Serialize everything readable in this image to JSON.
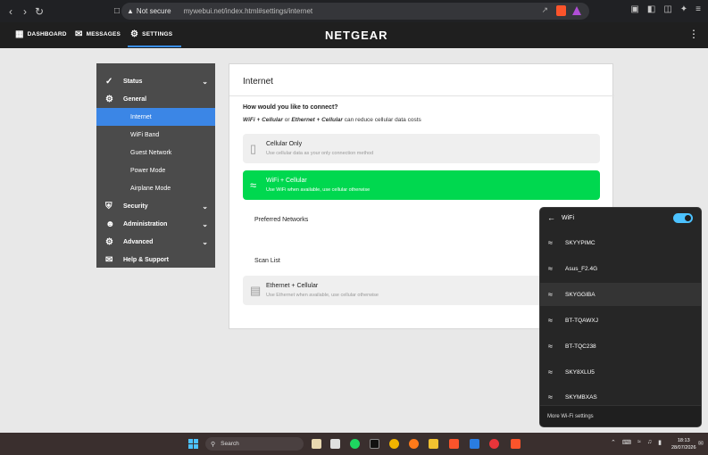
{
  "browser": {
    "security_label": "Not secure",
    "url": "mywebui.net/index.html#settings/internet"
  },
  "appnav": {
    "brand": "NETGEAR",
    "items": [
      "DASHBOARD",
      "MESSAGES",
      "SETTINGS"
    ],
    "active": "SETTINGS"
  },
  "sidebar": {
    "status": "Status",
    "general": "General",
    "general_items": [
      "Internet",
      "WiFi Band",
      "Guest Network",
      "Power Mode",
      "Airplane Mode"
    ],
    "security": "Security",
    "administration": "Administration",
    "advanced": "Advanced",
    "help": "Help & Support"
  },
  "main": {
    "title": "Internet",
    "question": "How would you like to connect?",
    "desc_a": "WiFi + Cellular",
    "desc_or": " or ",
    "desc_b": "Ethernet + Cellular",
    "desc_rest": " can reduce cellular data costs",
    "option_cell_title": "Cellular Only",
    "option_cell_desc": "Use cellular data as your only connection method",
    "option_wifi_title": "WiFi + Cellular",
    "option_wifi_desc": "Use WiFi when available, use cellular otherwise",
    "preferred": "Preferred Networks",
    "scan": "Scan List",
    "option_eth_title": "Ethernet + Cellular",
    "option_eth_desc": "Use Ethernet when available, use cellular otherwise"
  },
  "wifi_panel": {
    "title": "WiFi",
    "enabled": true,
    "networks": [
      "SKYYPIMC",
      "Asus_F2.4G",
      "SKYGGIBA",
      "BT-TQAWXJ",
      "BT-TQC238",
      "SKY8XLU5",
      "SKYMBXAS"
    ],
    "highlighted": "SKYGGIBA",
    "footer": "More Wi-Fi settings"
  },
  "taskbar": {
    "search": "Search",
    "time": "18:13",
    "date": "28/07/2026"
  },
  "colors": {
    "accent_blue": "#3b86e6",
    "selected_green": "#00d84f",
    "toggle_blue": "#4cc2ff"
  }
}
